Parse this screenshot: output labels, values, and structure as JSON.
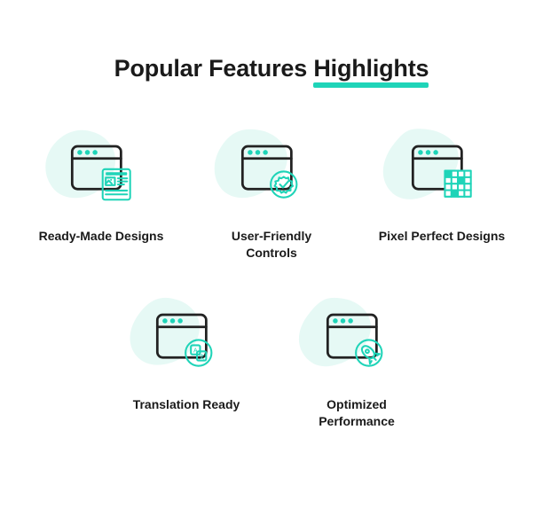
{
  "title": {
    "prefix": "Popular Features ",
    "highlight": "Highlights"
  },
  "features": [
    {
      "label": "Ready-Made Designs"
    },
    {
      "label": "User-Friendly Controls"
    },
    {
      "label": "Pixel Perfect Designs"
    },
    {
      "label": "Translation Ready"
    },
    {
      "label": "Optimized Performance"
    }
  ]
}
